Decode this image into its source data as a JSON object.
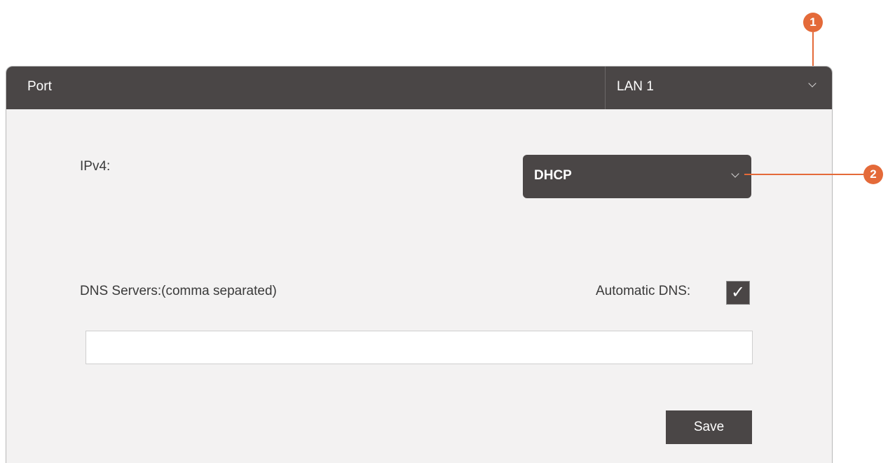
{
  "panel": {
    "header_label": "Port",
    "port_select_value": "LAN 1"
  },
  "form": {
    "ipv4_label": "IPv4:",
    "ipv4_value": "DHCP",
    "dns_label": "DNS Servers:(comma separated)",
    "auto_dns_label": "Automatic DNS:",
    "auto_dns_checked": true,
    "auto_dns_check_glyph": "✓",
    "dns_value": "",
    "save_label": "Save"
  },
  "callouts": {
    "one": "1",
    "two": "2"
  },
  "icons": {
    "port_dropdown": "chevron-down-icon",
    "ipv4_dropdown": "chevron-down-icon",
    "checkbox_mark": "checkmark-icon"
  },
  "colors": {
    "header_bg": "#4a4646",
    "panel_bg": "#f3f2f2",
    "callout": "#e46a39"
  }
}
